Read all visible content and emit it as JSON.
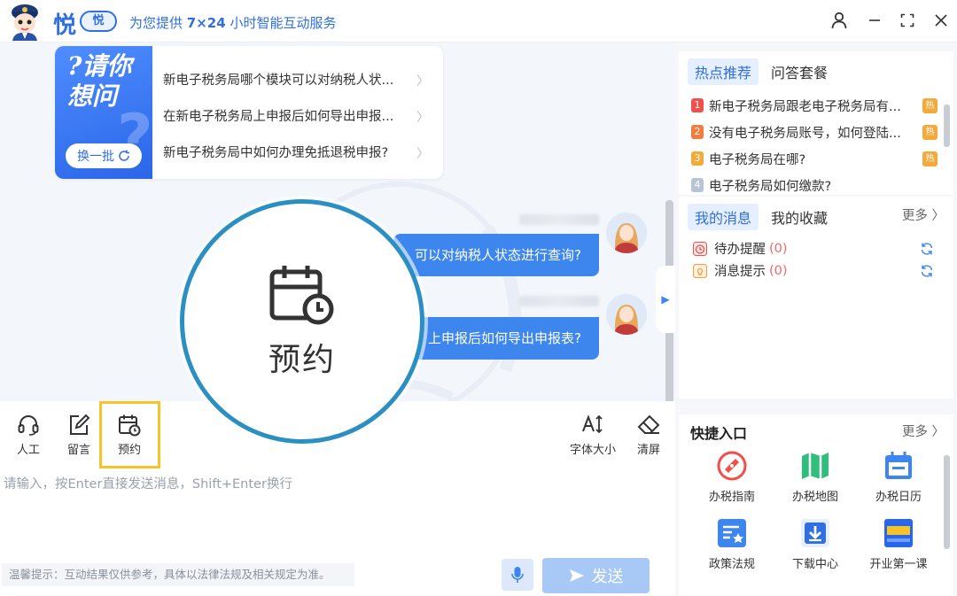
{
  "header": {
    "logo_text": "悦",
    "logo_badge": "悦",
    "slogan_prefix": "为您提供 ",
    "slogan_highlight": "7×24",
    "slogan_suffix": " 小时智能互动服务"
  },
  "ask_card": {
    "title_line1": "?请你",
    "title_line2": "想问",
    "refresh_label": "换一批",
    "items": [
      "新电子税务局哪个模块可以对纳税人状...",
      "在新电子税务局上申报后如何导出申报...",
      "新电子税务局中如何办理免抵退税申报?"
    ]
  },
  "messages": [
    {
      "text": "可以对纳税人状态进行查询?"
    },
    {
      "text": "上申报后如何导出申报表?"
    }
  ],
  "toolbar": {
    "human": "人工",
    "message": "留言",
    "appointment": "预约",
    "font_size": "字体大小",
    "clear": "清屏"
  },
  "magnifier": {
    "label": "预约"
  },
  "input": {
    "placeholder": "请输入，按Enter直接发送消息，Shift+Enter换行",
    "value": ""
  },
  "footer": {
    "tip": "温馨提示：互动结果仅供参考，具体以法律法规及相关规定为准。",
    "send_label": "发送"
  },
  "hot": {
    "tab_hot": "热点推荐",
    "tab_package": "问答套餐",
    "tag": "热",
    "items": [
      {
        "rank": "1",
        "text": "新电子税务局跟老电子税务局有...",
        "color": "#f0504b",
        "hot": true
      },
      {
        "rank": "2",
        "text": "没有电子税务局账号，如何登陆...",
        "color": "#f37b3b",
        "hot": true
      },
      {
        "rank": "3",
        "text": "电子税务局在哪?",
        "color": "#f4a93b",
        "hot": true
      },
      {
        "rank": "4",
        "text": "电子税务局如何缴款?",
        "color": "#b8c3d6",
        "hot": false
      }
    ]
  },
  "my": {
    "tab_messages": "我的消息",
    "tab_favorites": "我的收藏",
    "more": "更多",
    "items": [
      {
        "label": "待办提醒",
        "count": "(0)"
      },
      {
        "label": "消息提示",
        "count": "(0)"
      }
    ]
  },
  "quick": {
    "title": "快捷入口",
    "more": "更多",
    "items": [
      {
        "label": "办税指南",
        "icon": "compass-icon"
      },
      {
        "label": "办税地图",
        "icon": "map-icon"
      },
      {
        "label": "办税日历",
        "icon": "calendar-icon"
      },
      {
        "label": "政策法规",
        "icon": "policy-doc-icon"
      },
      {
        "label": "下载中心",
        "icon": "download-icon"
      },
      {
        "label": "开业第一课",
        "icon": "first-lesson-icon"
      }
    ],
    "first_lesson_badge": "开业第一课"
  },
  "colors": {
    "accent": "#2f6fe0",
    "bubble": "#3d86ee",
    "highlight": "#f6c428",
    "magnifier_ring": "#2b8fc2"
  }
}
